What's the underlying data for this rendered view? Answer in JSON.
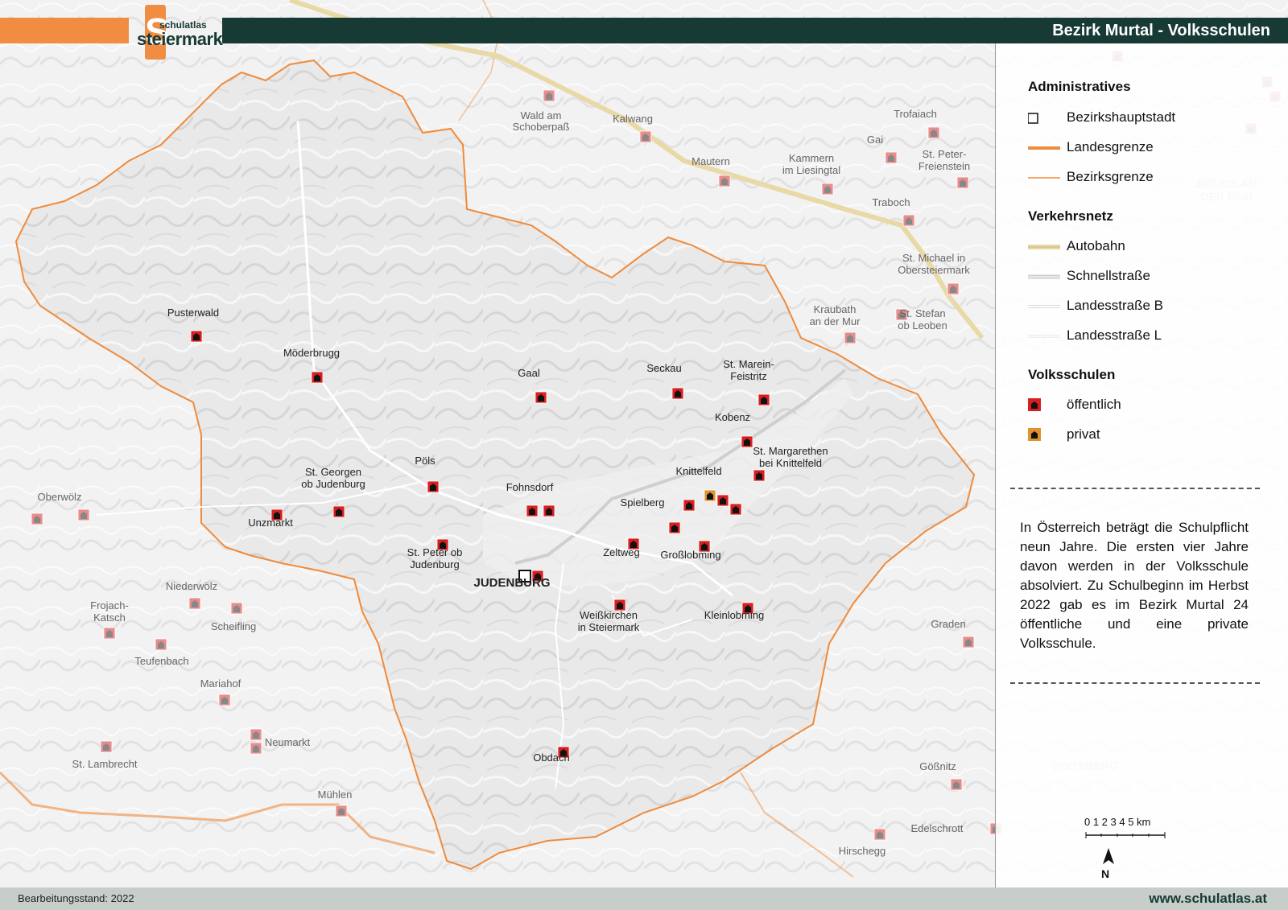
{
  "header": {
    "title": "Bezirk Murtal - Volksschulen",
    "logo_line1": "schulatlas",
    "logo_line2": "steiermark",
    "logo_letter": "S"
  },
  "colors": {
    "accent_orange": "#f08d42",
    "header_dark": "#173a35",
    "school_public": "#d81f1f",
    "school_private": "#e0932c",
    "school_outside": "#e88b8b",
    "border": "#ef8b3c"
  },
  "legend": {
    "admin_title": "Administratives",
    "admin_items": [
      "Bezirkshauptstadt",
      "Landesgrenze",
      "Bezirksgrenze"
    ],
    "traffic_title": "Verkehrsnetz",
    "traffic_items": [
      "Autobahn",
      "Schnellstraße",
      "Landesstraße B",
      "Landesstraße L"
    ],
    "schools_title": "Volksschulen",
    "schools_items": [
      "öffentlich",
      "privat"
    ],
    "description": "In Österreich beträgt die Schulpflicht neun Jahre. Die ersten vier Jahre davon werden in der Volksschule absolviert. Zu Schulbeginn im Herbst 2022 gab es im Bezirk Murtal 24 öffentliche und eine private Volksschule.",
    "scale_label": "0  1  2  3  4  5 km",
    "north_label": "N"
  },
  "footer": {
    "status": "Bearbeitungsstand: 2022",
    "website": "www.schulatlas.at"
  },
  "places_inside": [
    "Pusterwald",
    "Möderbrugg",
    "Gaal",
    "Seckau",
    "St. Marein-",
    "Feistritz",
    "Kobenz",
    "St. Margarethen",
    "bei Knittelfeld",
    "Knittelfeld",
    "Pöls",
    "St. Georgen",
    "ob Judenburg",
    "Fohnsdorf",
    "Spielberg",
    "Unzmarkt",
    "St. Peter ob",
    "Judenburg",
    "Zeltweg",
    "Großlobming",
    "JUDENBURG",
    "Weißkirchen",
    "in Steiermark",
    "Kleinlobming",
    "Obdach"
  ],
  "places_outside": [
    "Wald am",
    "Schoberpaß",
    "Kalwang",
    "Trofaiach",
    "Gai",
    "Kammern",
    "im Liesingtal",
    "Mautern",
    "St. Peter-",
    "Freienstein",
    "Traboch",
    "St. Michael in",
    "Obersteiermark",
    "Kraubath",
    "an der Mur",
    "St. Stefan",
    "ob Leoben",
    "Oberwölz",
    "Niederwölz",
    "Frojach-",
    "Katsch",
    "Scheifling",
    "Teufenbach",
    "Mariahof",
    "Neumarkt",
    "St. Lambrecht",
    "Mühlen",
    "Graden",
    "Gößnitz",
    "Edelschrott",
    "Hirschegg",
    "BRUCK AN",
    "DER MUR",
    "VOITSBERG"
  ]
}
